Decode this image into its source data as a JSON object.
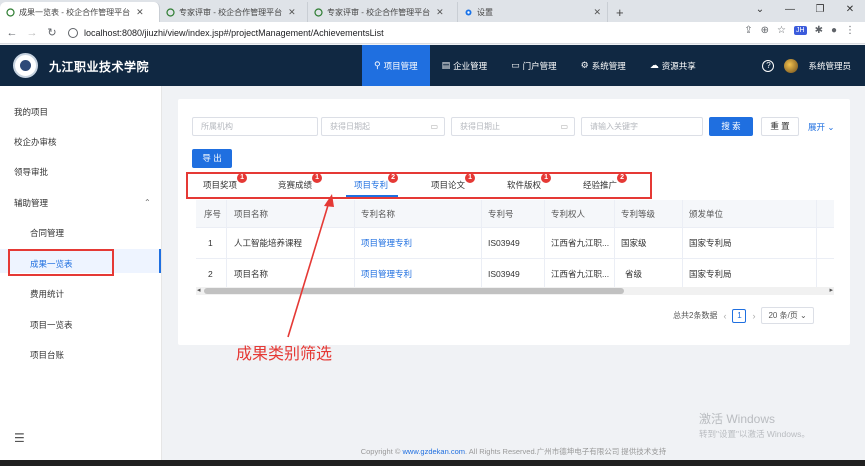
{
  "browser": {
    "tabs": [
      {
        "title": "成果一览表 - 校企合作管理平台",
        "active": true
      },
      {
        "title": "专家评审 - 校企合作管理平台",
        "active": false
      },
      {
        "title": "专家评审 - 校企合作管理平台",
        "active": false
      },
      {
        "title": "设置",
        "active": false
      }
    ],
    "url": "localhost:8080/jiuzhi/view/index.jsp#/projectManagement/AchievementsList",
    "ext_badge": "JH"
  },
  "header": {
    "brand": "九江职业技术学院",
    "nav": [
      {
        "label": "项目管理",
        "icon": "org-icon",
        "active": true
      },
      {
        "label": "企业管理",
        "icon": "building-icon",
        "active": false
      },
      {
        "label": "门户管理",
        "icon": "monitor-icon",
        "active": false
      },
      {
        "label": "系统管理",
        "icon": "gear-icon",
        "active": false
      },
      {
        "label": "资源共享",
        "icon": "cloud-icon",
        "active": false
      }
    ],
    "user": "系统管理员"
  },
  "sidebar": {
    "items": [
      "我的项目",
      "校企办审核",
      "领导审批",
      "辅助管理"
    ],
    "sub_items": [
      "合同管理",
      "成果一览表",
      "费用统计",
      "项目一览表",
      "项目台账"
    ],
    "active_sub": "成果一览表"
  },
  "filters": {
    "org_placeholder": "所属机构",
    "date_start_placeholder": "获得日期起",
    "date_end_placeholder": "获得日期止",
    "keyword_placeholder": "请输入关键字",
    "search_label": "搜 索",
    "reset_label": "重 置",
    "expand_label": "展开"
  },
  "export_label": "导 出",
  "category_tabs": [
    {
      "label": "项目奖项",
      "badge": "1"
    },
    {
      "label": "竞赛成绩",
      "badge": "1"
    },
    {
      "label": "项目专利",
      "badge": "2",
      "active": true
    },
    {
      "label": "项目论文",
      "badge": "1"
    },
    {
      "label": "软件版权",
      "badge": "1"
    },
    {
      "label": "经验推广",
      "badge": "2"
    }
  ],
  "table": {
    "columns": [
      "序号",
      "项目名称",
      "专利名称",
      "专利号",
      "专利权人",
      "专利等级",
      "颁发单位"
    ],
    "rows": [
      [
        "1",
        "人工智能培养课程",
        "项目管理专利",
        "IS03949",
        "江西省九江职...",
        "国家级",
        "国家专利局"
      ],
      [
        "2",
        "项目名称",
        "项目管理专利",
        "IS03949",
        "江西省九江职...",
        "省级",
        "国家专利局"
      ]
    ]
  },
  "pagination": {
    "total": "总共2条数据",
    "current": "1",
    "page_size": "20 条/页"
  },
  "annotation": "成果类别筛选",
  "watermark": {
    "line1": "激活 Windows",
    "line2": "转到\"设置\"以激活 Windows。"
  },
  "footer": {
    "pre": "Copyright ©",
    "link": "www.gzdekan.com",
    "post": ". All Rights Reserved.广州市德坤电子有限公司 提供技术支持"
  }
}
